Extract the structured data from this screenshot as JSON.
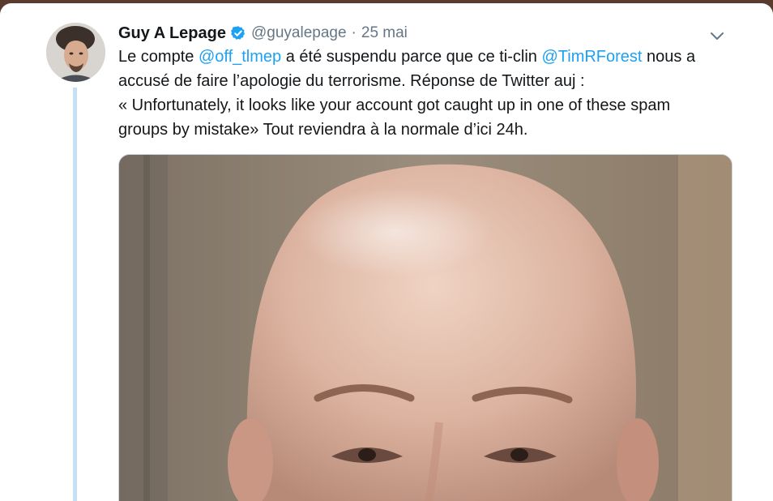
{
  "tweet": {
    "author": {
      "display_name": "Guy A Lepage",
      "verified": true,
      "handle": "@guyalepage",
      "avatar_icon": "avatar-photo"
    },
    "separator": "·",
    "date": "25 mai",
    "text": {
      "line1": {
        "part1": "Le compte ",
        "mention1": "@off_tlmep",
        "part2": " a été suspendu parce que ce ti-clin ",
        "mention2": "@TimRForest",
        "part3": " nous a"
      },
      "line2": "accusé de faire l’apologie du terrorisme. Réponse de Twitter auj :",
      "line3": "« Unfortunately, it looks like your account got caught up in one of these spam",
      "line4": "groups by mistake» Tout reviendra à la normale d’ici 24h."
    },
    "media": {
      "icon": "photo-man-portrait"
    },
    "menu_icon": "chevron-down-icon"
  },
  "colors": {
    "link": "#1da1f2",
    "text": "#14171a",
    "muted": "#657786",
    "thread_line": "#c6e1f6",
    "verified": "#1da1f2"
  }
}
